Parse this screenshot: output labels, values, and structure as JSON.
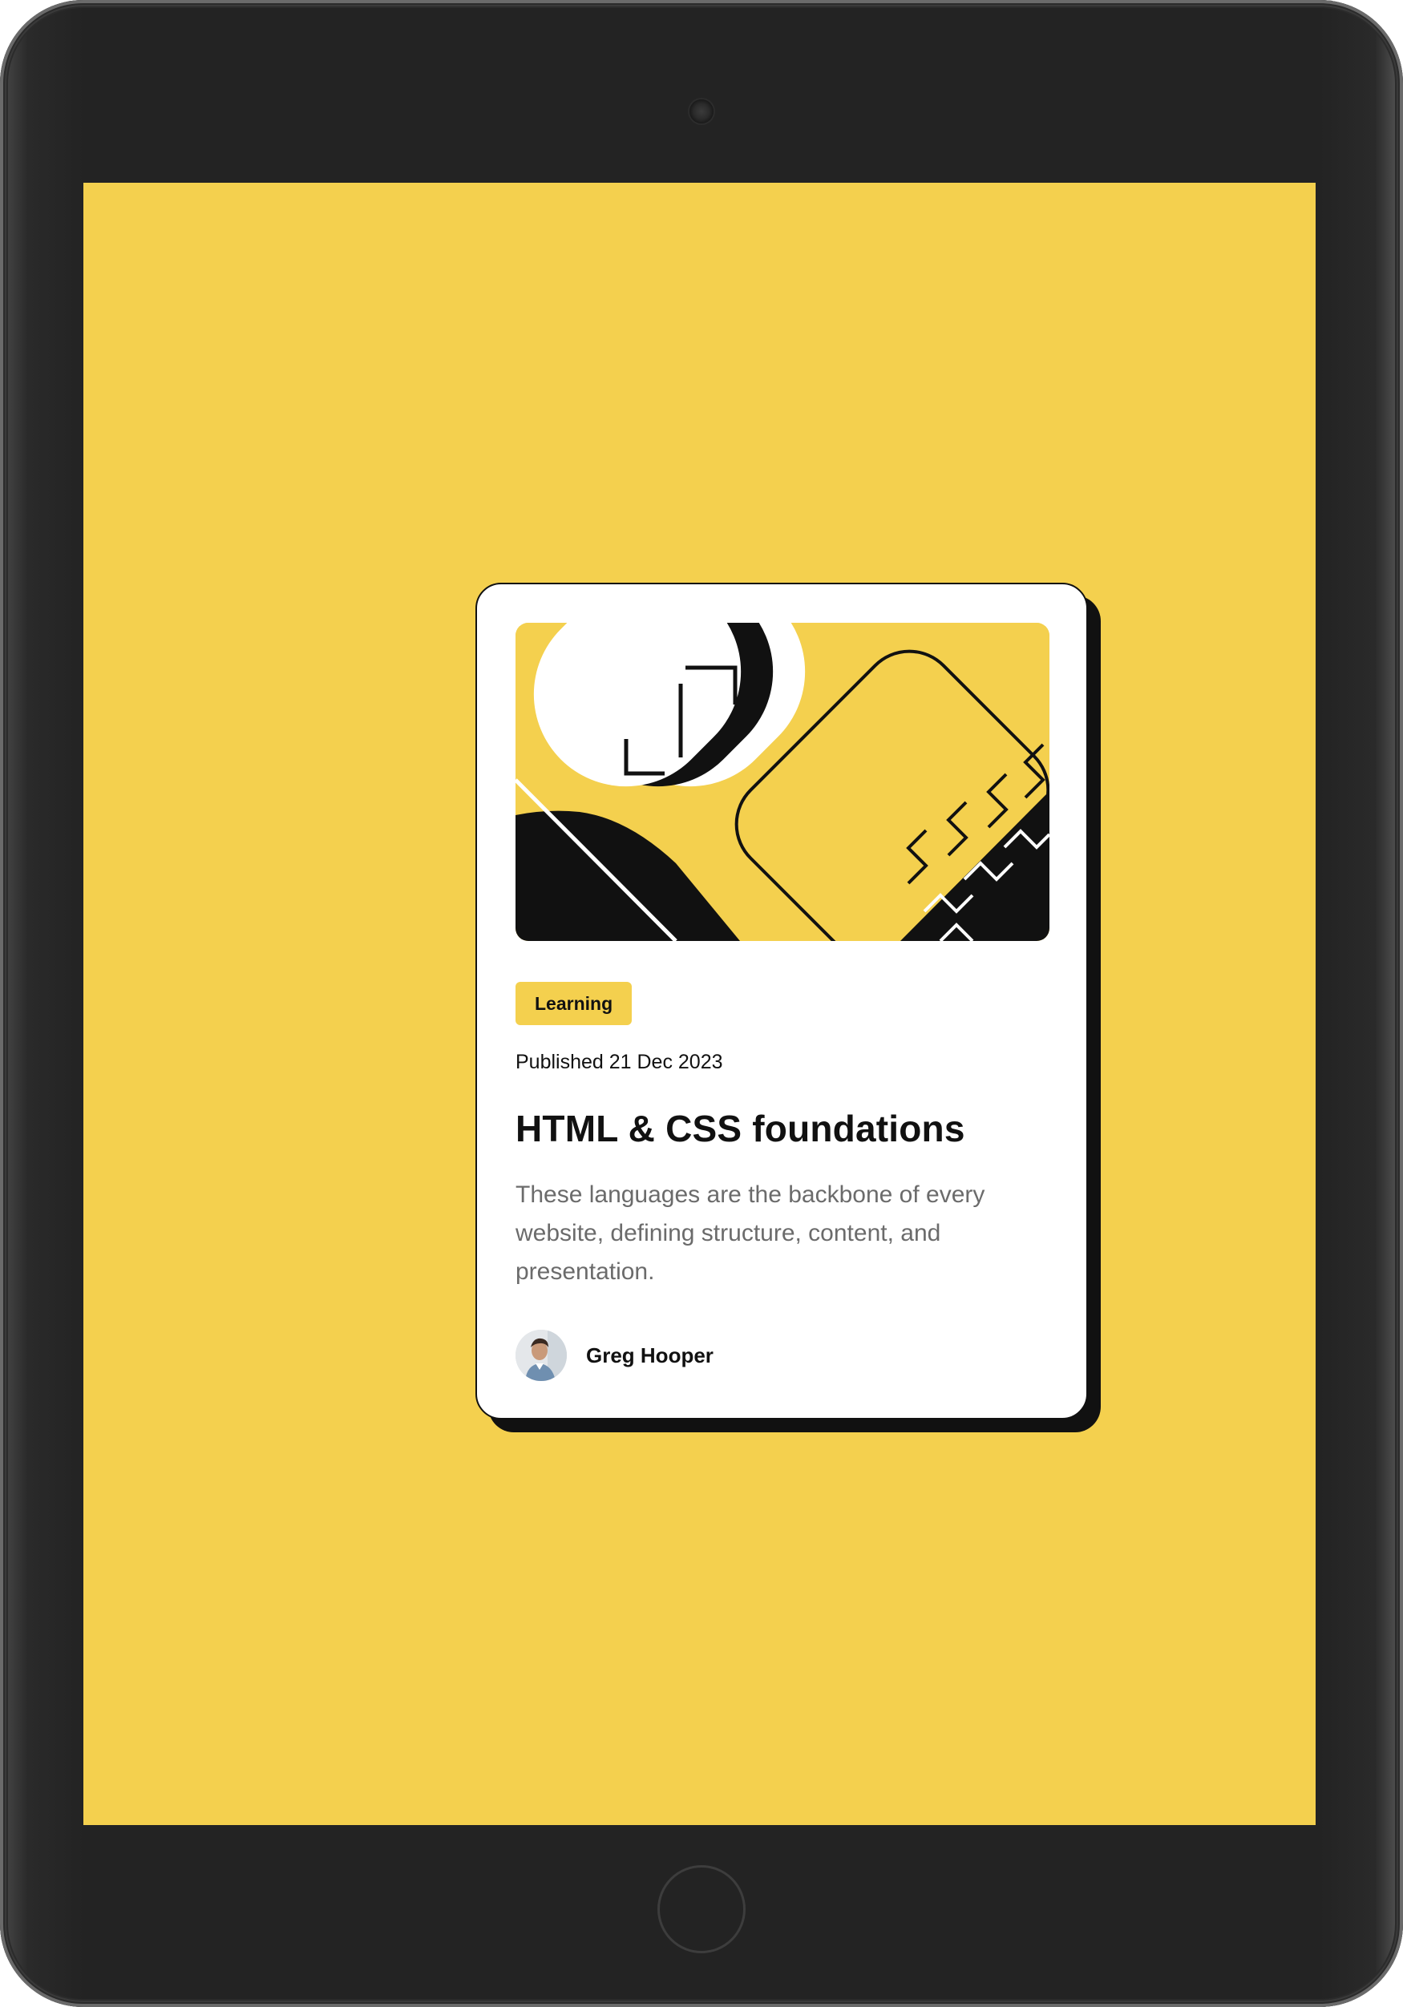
{
  "card": {
    "tag": "Learning",
    "published": "Published 21 Dec 2023",
    "title": "HTML & CSS foundations",
    "description": "These languages are the backbone of every website, defining structure, content, and presentation.",
    "author": "Greg Hooper"
  },
  "colors": {
    "background": "#f4d04e",
    "card": "#ffffff",
    "ink": "#111111",
    "muted_text": "#6b6b6b",
    "device_bezel": "#232323"
  }
}
